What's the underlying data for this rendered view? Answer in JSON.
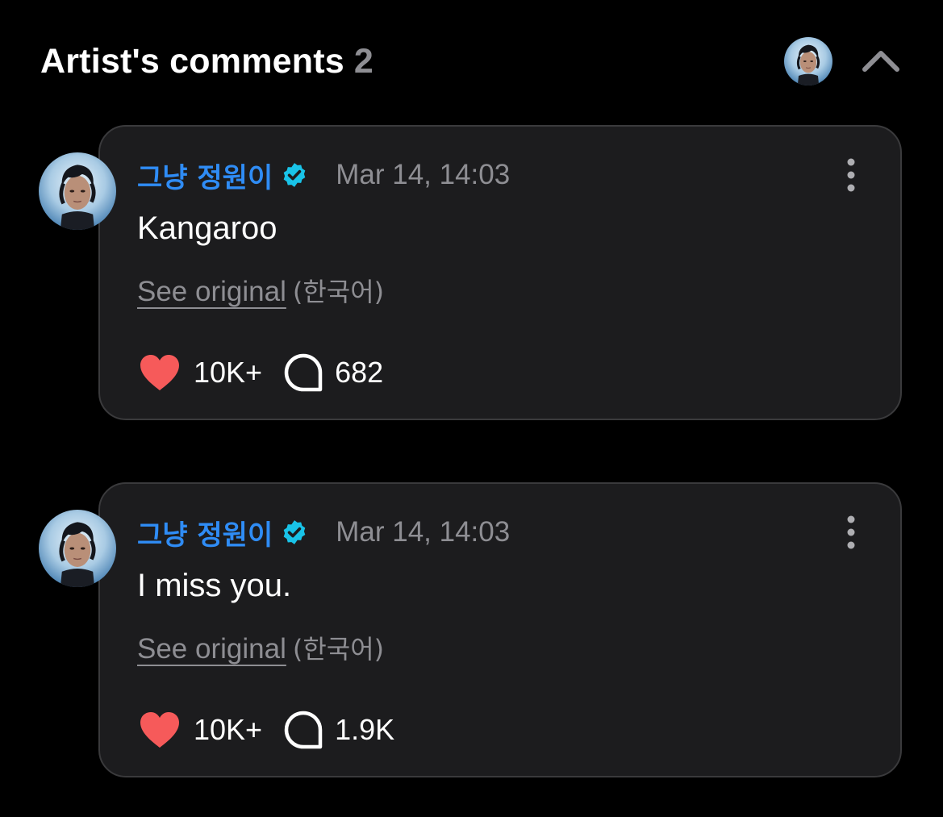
{
  "header": {
    "title": "Artist's comments",
    "count": "2"
  },
  "colors": {
    "background": "#000000",
    "card_background": "#1c1c1e",
    "author_name": "#2f8cf5",
    "verified_badge": "#19c3e8",
    "muted_text": "#8e8e93",
    "heart": "#f65a5a"
  },
  "comments": [
    {
      "author": "그냥 정원이",
      "verified": true,
      "timestamp": "Mar 14, 14:03",
      "text": "Kangaroo",
      "see_original_label": "See original",
      "original_language": "(한국어)",
      "likes": "10K+",
      "replies": "682"
    },
    {
      "author": "그냥 정원이",
      "verified": true,
      "timestamp": "Mar 14, 14:03",
      "text": "I miss you.",
      "see_original_label": "See original",
      "original_language": "(한국어)",
      "likes": "10K+",
      "replies": "1.9K"
    }
  ],
  "icons": {
    "collapse": "chevron-up-icon",
    "verified": "verified-badge-icon",
    "more": "more-vertical-icon",
    "like": "heart-icon",
    "reply": "speech-bubble-icon"
  }
}
